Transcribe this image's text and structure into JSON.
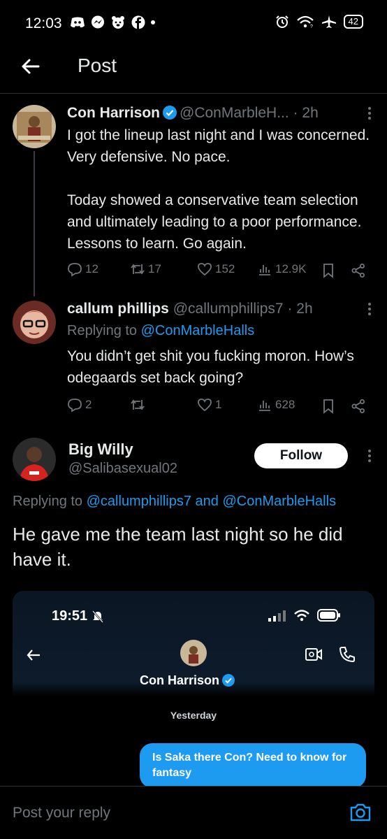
{
  "status_bar": {
    "time": "12:03",
    "battery": "42",
    "icons": [
      "discord-icon",
      "messenger-icon",
      "bear-icon",
      "facebook-icon",
      "dot-icon",
      "alarm-icon",
      "wifi-icon",
      "airplane-icon",
      "battery-icon"
    ]
  },
  "header": {
    "title": "Post",
    "back_icon": "arrow-left-icon"
  },
  "colors": {
    "background": "#000000",
    "text": "#e7e9ea",
    "muted": "#71767b",
    "accent": "#1d9bf0",
    "divider": "#2f3336"
  },
  "thread": [
    {
      "name": "Con Harrison",
      "handle": "@ConMarbleH...",
      "time": "· 2h",
      "verified": true,
      "body": "I got the lineup last night and I was concerned. Very defensive. No pace.\n\nToday showed a conservative team selection and ultimately leading to a poor performance. Lessons to learn. Go again.",
      "replies": "12",
      "reposts": "17",
      "likes": "152",
      "views": "12.9K"
    },
    {
      "name": "callum phillips",
      "handle": "@callumphillips7",
      "time": "· 2h",
      "reply_prefix": "Replying to ",
      "reply_to": "@ConMarbleHalls",
      "body": "You didn’t get shit you fucking moron. How’s odegaards set back going?",
      "replies": "2",
      "reposts": "",
      "likes": "1",
      "views": "628"
    }
  ],
  "main_post": {
    "name": "Big Willy",
    "handle": "@Salibasexual02",
    "follow_label": "Follow",
    "reply_prefix": "Replying to ",
    "reply_to_1": "@callumphillips7",
    "reply_and": " and ",
    "reply_to_2": "@ConMarbleHalls",
    "text": "He gave me the team last night so he did have it.",
    "embedded": {
      "time": "19:51",
      "contact_name": "Con Harrison",
      "date_label": "Yesterday",
      "message": "Is Saka there Con? Need to know for fantasy"
    }
  },
  "reply_bar": {
    "placeholder": "Post your reply",
    "camera_icon": "camera-icon"
  }
}
